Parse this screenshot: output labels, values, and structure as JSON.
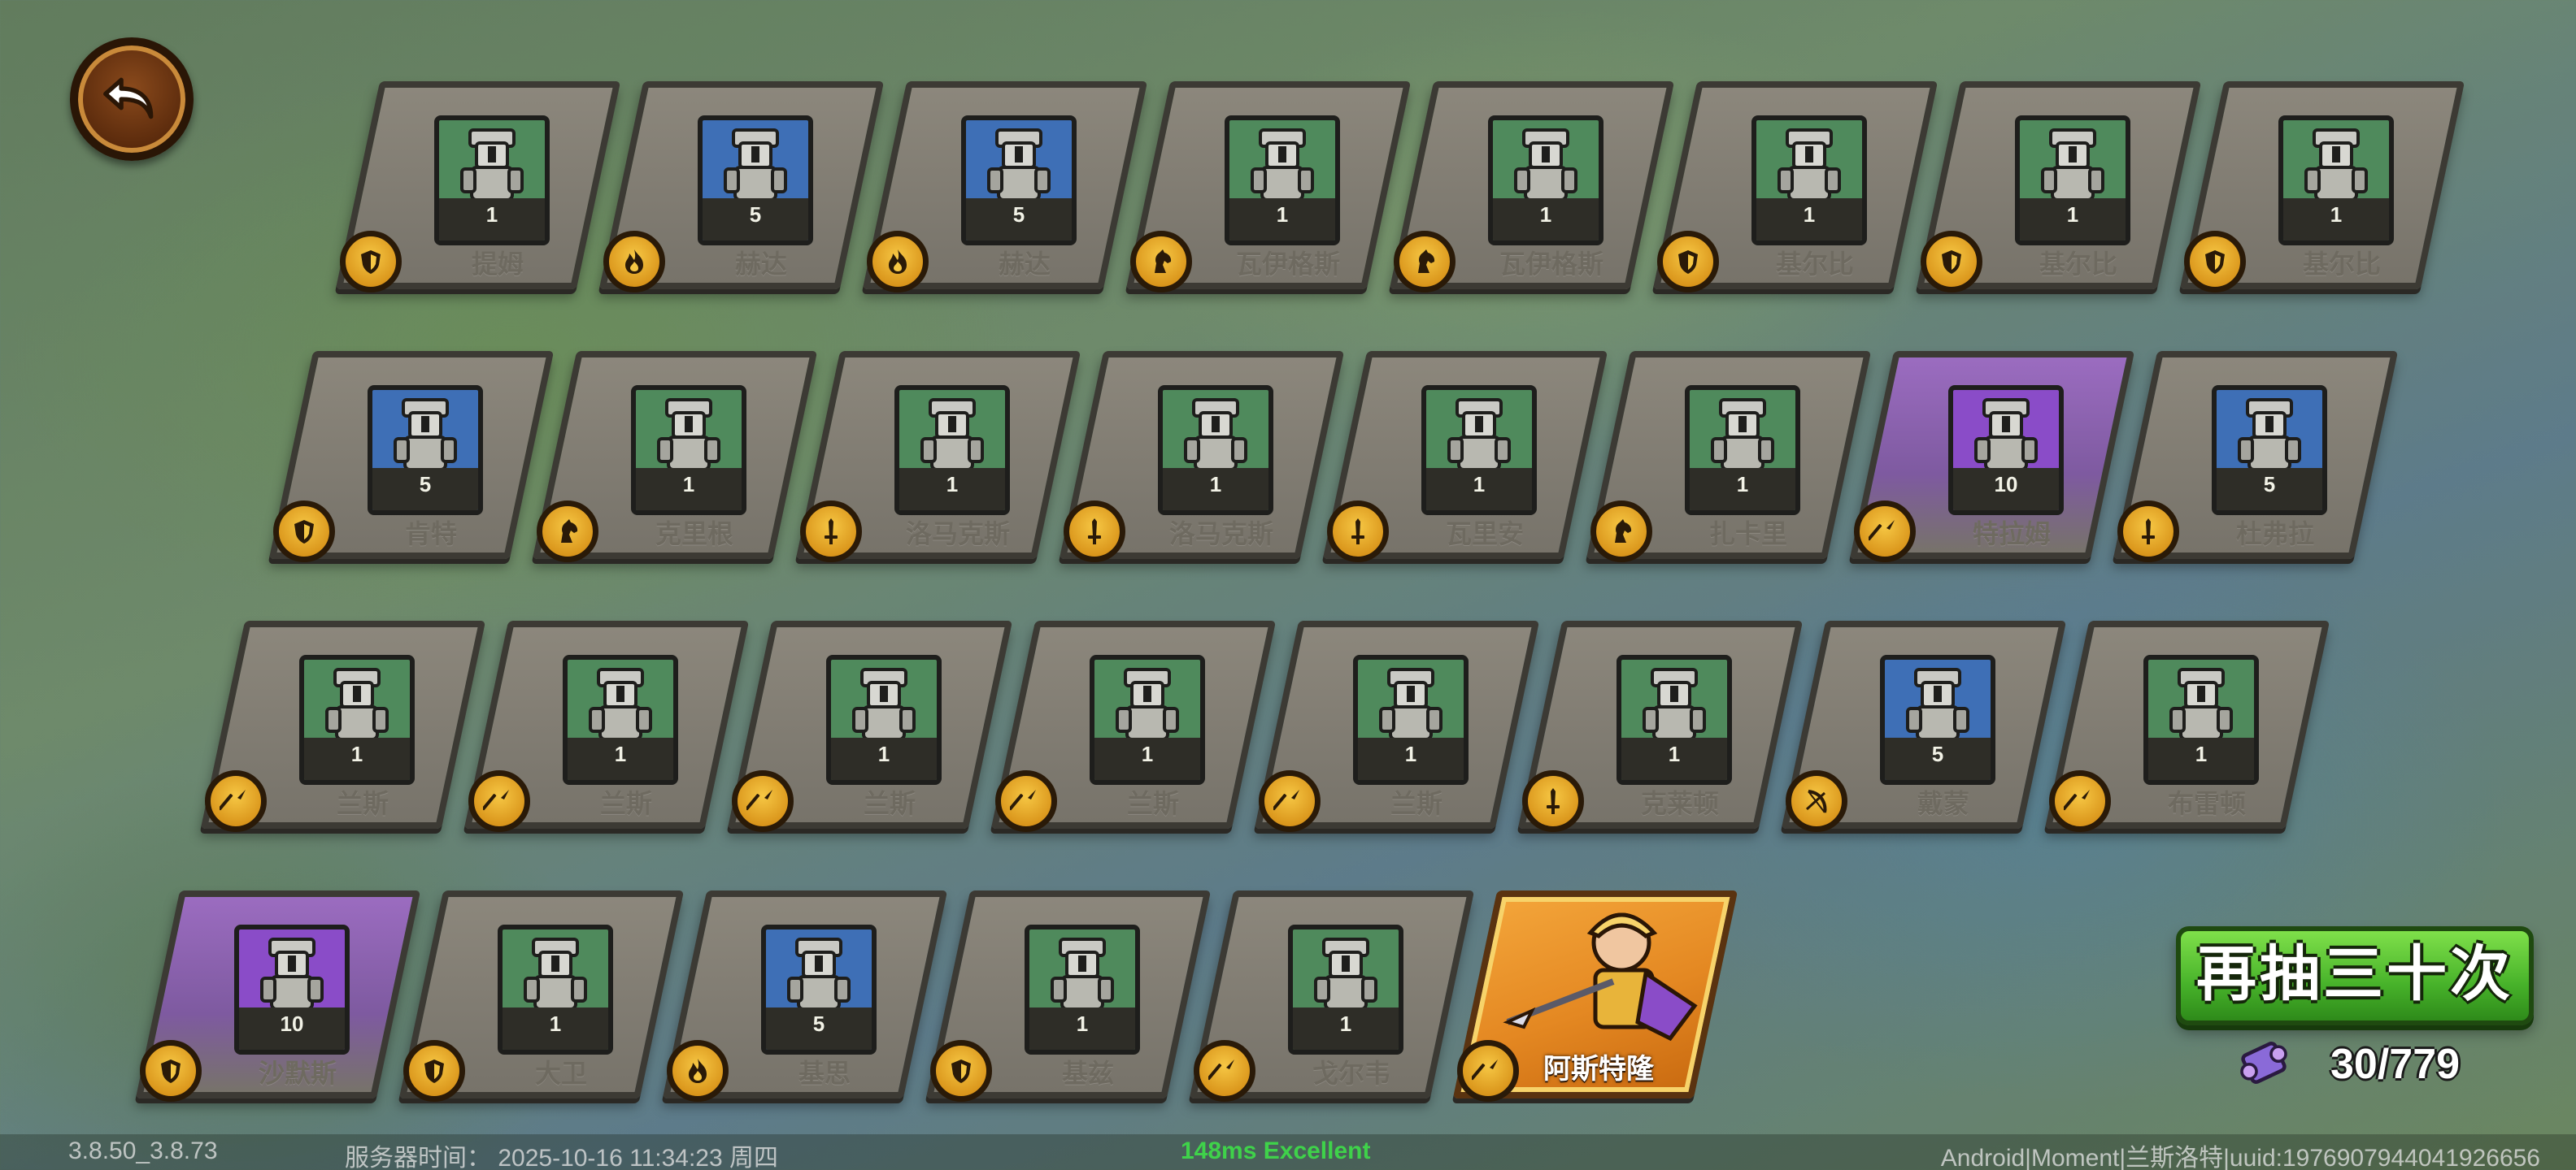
{
  "back_button": {
    "icon": "back-arrow-icon"
  },
  "rows": [
    [
      {
        "name": "提姆",
        "count": "1",
        "bg": "green",
        "cls": "shield"
      },
      {
        "name": "赫达",
        "count": "5",
        "bg": "blue",
        "cls": "flame"
      },
      {
        "name": "赫达",
        "count": "5",
        "bg": "blue",
        "cls": "flame"
      },
      {
        "name": "瓦伊格斯",
        "count": "1",
        "bg": "green",
        "cls": "horse"
      },
      {
        "name": "瓦伊格斯",
        "count": "1",
        "bg": "green",
        "cls": "horse"
      },
      {
        "name": "基尔比",
        "count": "1",
        "bg": "green",
        "cls": "shield"
      },
      {
        "name": "基尔比",
        "count": "1",
        "bg": "green",
        "cls": "shield"
      },
      {
        "name": "基尔比",
        "count": "1",
        "bg": "green",
        "cls": "shield"
      }
    ],
    [
      {
        "name": "肯特",
        "count": "5",
        "bg": "blue",
        "cls": "shield"
      },
      {
        "name": "克里根",
        "count": "1",
        "bg": "green",
        "cls": "horse"
      },
      {
        "name": "洛马克斯",
        "count": "1",
        "bg": "green",
        "cls": "sword"
      },
      {
        "name": "洛马克斯",
        "count": "1",
        "bg": "green",
        "cls": "sword"
      },
      {
        "name": "瓦里安",
        "count": "1",
        "bg": "green",
        "cls": "sword"
      },
      {
        "name": "扎卡里",
        "count": "1",
        "bg": "green",
        "cls": "horse"
      },
      {
        "name": "特拉姆",
        "count": "10",
        "bg": "purple",
        "cls": "spear"
      },
      {
        "name": "杜弗拉",
        "count": "5",
        "bg": "blue",
        "cls": "sword"
      }
    ],
    [
      {
        "name": "兰斯",
        "count": "1",
        "bg": "green",
        "cls": "spear"
      },
      {
        "name": "兰斯",
        "count": "1",
        "bg": "green",
        "cls": "spear"
      },
      {
        "name": "兰斯",
        "count": "1",
        "bg": "green",
        "cls": "spear"
      },
      {
        "name": "兰斯",
        "count": "1",
        "bg": "green",
        "cls": "spear"
      },
      {
        "name": "兰斯",
        "count": "1",
        "bg": "green",
        "cls": "spear"
      },
      {
        "name": "克莱顿",
        "count": "1",
        "bg": "green",
        "cls": "sword"
      },
      {
        "name": "戴蒙",
        "count": "5",
        "bg": "blue",
        "cls": "bow"
      },
      {
        "name": "布雷顿",
        "count": "1",
        "bg": "green",
        "cls": "spear"
      }
    ],
    [
      {
        "name": "沙默斯",
        "count": "10",
        "bg": "purple",
        "cls": "shield"
      },
      {
        "name": "大卫",
        "count": "1",
        "bg": "green",
        "cls": "shield"
      },
      {
        "name": "基思",
        "count": "5",
        "bg": "blue",
        "cls": "flame"
      },
      {
        "name": "基兹",
        "count": "1",
        "bg": "green",
        "cls": "shield"
      },
      {
        "name": "戈尔韦",
        "count": "1",
        "bg": "green",
        "cls": "spear"
      },
      {
        "name": "阿斯特隆",
        "count": "",
        "bg": "hero",
        "cls": "spear"
      }
    ]
  ],
  "redraw": {
    "label": "再抽三十次"
  },
  "scroll": {
    "icon": "summon-scroll-icon",
    "count": "30/779"
  },
  "status": {
    "version": "3.8.50_3.8.73",
    "server_time": "服务器时间：  2025-10-16  11:34:23  周四",
    "ping": "148ms Excellent",
    "device": "Android|Moment|兰斯洛特|uuid:1976907944041926656"
  },
  "colors": {
    "green": "#4f8a5c",
    "blue": "#3e6fb6",
    "purple": "#8a4cc8",
    "hero": "#e48822",
    "accent_button": "#47b22a"
  }
}
